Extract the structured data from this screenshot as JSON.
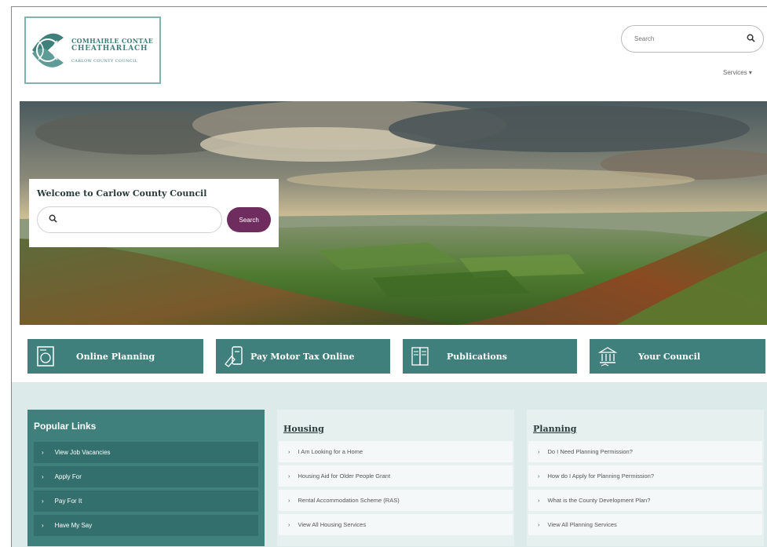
{
  "header": {
    "logo": {
      "line1": "COMHAIRLE CONTAE",
      "line2": "CHEATHARLACH",
      "line3": "CARLOW COUNTY COUNCIL"
    },
    "search": {
      "placeholder": "Search",
      "icon": "search-icon"
    },
    "services_label": "Services ▾"
  },
  "hero": {
    "welcome_title": "Welcome to Carlow County Council",
    "search_button": "Search",
    "search_icon": "search-icon"
  },
  "tiles": [
    {
      "label": "Online Planning",
      "icon": "planning-icon"
    },
    {
      "label": "Pay Motor Tax Online",
      "icon": "mobile-payment-icon"
    },
    {
      "label": "Publications",
      "icon": "publications-icon"
    },
    {
      "label": "Your Council",
      "icon": "council-building-icon"
    }
  ],
  "popular_links": {
    "title": "Popular Links",
    "items": [
      "View Job Vacancies",
      "Apply For",
      "Pay For It",
      "Have My Say"
    ]
  },
  "housing": {
    "title": "Housing",
    "items": [
      "I Am Looking for a Home",
      "Housing Aid for Older People Grant",
      "Rental Accommodation Scheme (RAS)",
      "View All Housing Services"
    ]
  },
  "planning": {
    "title": "Planning",
    "items": [
      "Do I Need Planning Permission?",
      "How do I Apply for Planning Permission?",
      "What is the County Development Plan?",
      "View All Planning Services"
    ]
  },
  "colors": {
    "teal": "#3f7f7c",
    "purple": "#6f2d5f",
    "section_bg": "#dcebea"
  }
}
